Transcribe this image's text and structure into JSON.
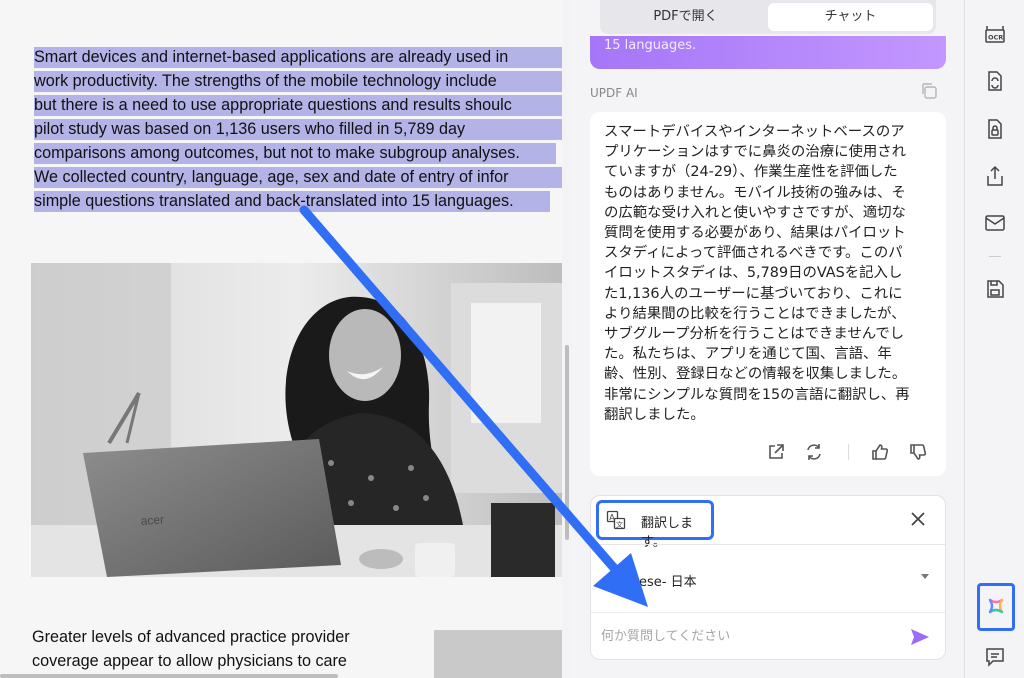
{
  "pdf": {
    "highlighted_lines": [
      "Smart devices and internet-based applications are already used in",
      "work productivity. The strengths of the mobile technology include",
      "but there is a need to use appropriate questions and results shoulc",
      "pilot study was based on 1,136 users who filled in 5,789 day",
      "comparisons among outcomes, but not to make subgroup analyses.",
      "We collected country, language, age, sex and date of entry of infor",
      "simple questions translated and back-translated into 15 languages."
    ],
    "lower_lines": [
      "Greater levels of advanced practice provider",
      "coverage appear to allow physicians to care"
    ]
  },
  "panel": {
    "tabs": [
      {
        "label": "PDFで開く",
        "active": false
      },
      {
        "label": "チャット",
        "active": true
      }
    ],
    "user_message_tail": "15 languages.",
    "ai_label": "UPDF AI",
    "answer_lines": [
      "スマートデバイスやインターネットベースのア",
      "プリケーションはすでに鼻炎の治療に使用され",
      "ていますが（24-29）、作業生産性を評価した",
      "ものはありません。モバイル技術の強みは、そ",
      "の広範な受け入れと使いやすさですが、適切な",
      "質問を使用する必要があり、結果はパイロット",
      "スタディによって評価されるべきです。このパ",
      "イロットスタディは、5,789日のVASを記入し",
      "た1,136人のユーザーに基づいており、これに",
      "より結果間の比較を行うことはできましたが、",
      "サブグループ分析を行うことはできませんでし",
      "た。私たちは、アプリを通じて国、言語、年",
      "齢、性別、登録日などの情報を収集しました。",
      "非常にシンプルな質問を15の言語に翻訳し、再",
      "翻訳しました。"
    ],
    "prompt_chip_label": "翻訳します。",
    "language_value": "ese- 日本",
    "input_placeholder": "何か質問してください"
  },
  "colors": {
    "highlight": "#b3b3e8",
    "accent_purple": "#a576f7",
    "annotation_blue": "#2f6ef5",
    "send_purple": "#9b6cf5"
  }
}
